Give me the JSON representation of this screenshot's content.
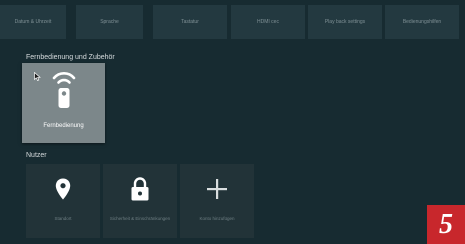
{
  "top_menu": {
    "items": [
      {
        "label": "Datum & Uhrzeit"
      },
      {
        "label": "Sprache"
      },
      {
        "label": "Tastatur"
      },
      {
        "label": "HDMI cec"
      },
      {
        "label": "Play back settings"
      },
      {
        "label": "Bedienungshilfen"
      }
    ]
  },
  "remote_section": {
    "title": "Fernbedienung und Zubehör",
    "tile_label": "Fernbedienung",
    "tile_icon": "remote-control-icon"
  },
  "users_section": {
    "title": "Nutzer",
    "tiles": [
      {
        "label": "Standort",
        "icon": "location-pin-icon"
      },
      {
        "label": "Sicherheit & Einschränkungen",
        "icon": "lock-icon"
      },
      {
        "label": "Konto hinzufügen",
        "icon": "plus-icon"
      }
    ]
  },
  "badge": {
    "text": "5"
  },
  "colors": {
    "background": "#172b31",
    "tile_dark": "#223338",
    "tile_focused": "#7c878a",
    "badge_red": "#c8272c"
  }
}
